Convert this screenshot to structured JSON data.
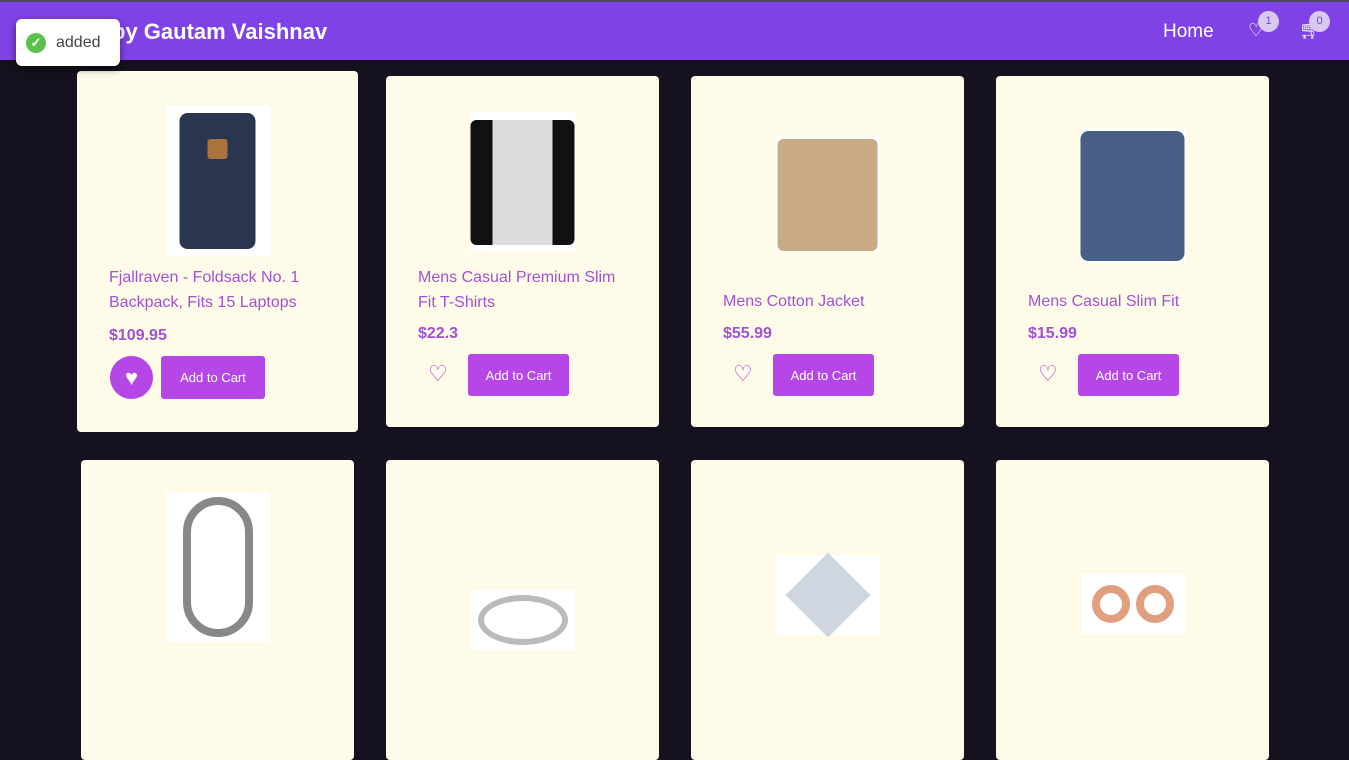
{
  "header": {
    "brand": "by Gautam Vaishnav",
    "home": "Home",
    "wishlist_count": "1",
    "cart_count": "0"
  },
  "toast": {
    "message": "added"
  },
  "colors": {
    "header": "#7f42e6",
    "card": "#fffbe9",
    "accent": "#b547e6",
    "background": "#15111e"
  },
  "products": [
    {
      "title": "Fjallraven - Foldsack No. 1 Backpack, Fits 15 Laptops",
      "price": "$109.95",
      "button": "Add to Cart",
      "wishlisted": true
    },
    {
      "title": "Mens Casual Premium Slim Fit T-Shirts",
      "price": "$22.3",
      "button": "Add to Cart",
      "wishlisted": false
    },
    {
      "title": "Mens Cotton Jacket",
      "price": "$55.99",
      "button": "Add to Cart",
      "wishlisted": false
    },
    {
      "title": "Mens Casual Slim Fit",
      "price": "$15.99",
      "button": "Add to Cart",
      "wishlisted": false
    }
  ]
}
